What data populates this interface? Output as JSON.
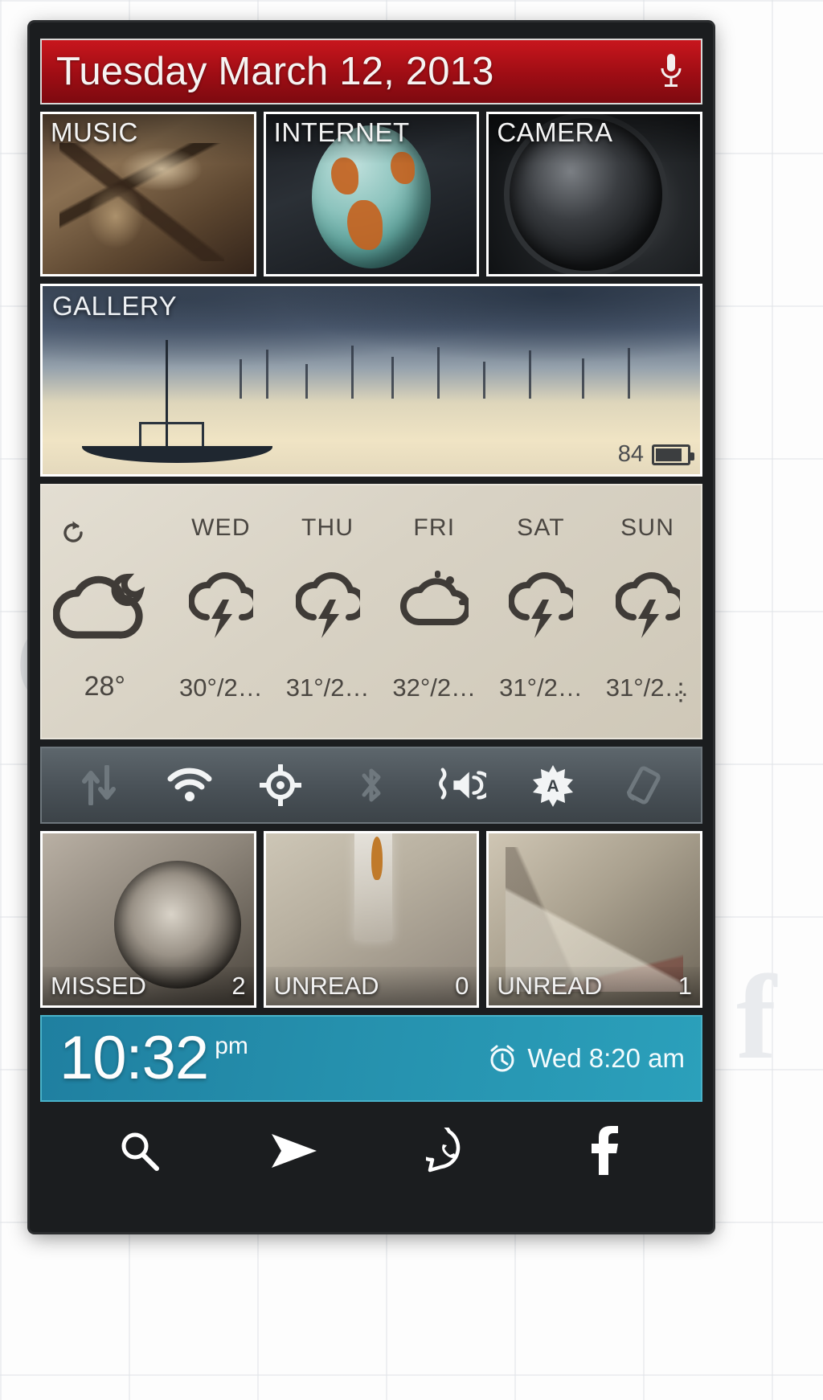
{
  "header": {
    "date": "Tuesday March 12, 2013",
    "mic_icon": "microphone-icon"
  },
  "app_tiles": [
    {
      "label": "MUSIC",
      "icon": "gramophone-image"
    },
    {
      "label": "INTERNET",
      "icon": "globe-image"
    },
    {
      "label": "CAMERA",
      "icon": "camera-lens-image"
    }
  ],
  "gallery": {
    "label": "GALLERY",
    "battery_level": "84",
    "battery_icon": "battery-icon"
  },
  "weather": {
    "refresh_icon": "refresh-icon",
    "more_icon": "overflow-menu-icon",
    "today": {
      "temp": "28°",
      "icon": "cloudy-night-icon"
    },
    "days": [
      {
        "day": "WED",
        "temp": "30°/2…",
        "icon": "thunderstorm-icon"
      },
      {
        "day": "THU",
        "temp": "31°/2…",
        "icon": "thunderstorm-icon"
      },
      {
        "day": "FRI",
        "temp": "32°/2…",
        "icon": "partly-cloudy-icon"
      },
      {
        "day": "SAT",
        "temp": "31°/2…",
        "icon": "thunderstorm-icon"
      },
      {
        "day": "SUN",
        "temp": "31°/2…",
        "icon": "thunderstorm-icon"
      }
    ]
  },
  "toggles": [
    {
      "name": "data-toggle",
      "icon": "data-transfer-icon",
      "state": "off"
    },
    {
      "name": "wifi-toggle",
      "icon": "wifi-icon",
      "state": "on"
    },
    {
      "name": "gps-toggle",
      "icon": "location-icon",
      "state": "on"
    },
    {
      "name": "bluetooth-toggle",
      "icon": "bluetooth-icon",
      "state": "off"
    },
    {
      "name": "sound-toggle",
      "icon": "volume-icon",
      "state": "on"
    },
    {
      "name": "autobrightness-toggle",
      "icon": "brightness-auto-icon",
      "state": "on"
    },
    {
      "name": "rotation-toggle",
      "icon": "screen-rotation-icon",
      "state": "off"
    }
  ],
  "notifications": [
    {
      "label": "MISSED",
      "count": "2",
      "icon": "rotary-phone-image"
    },
    {
      "label": "UNREAD",
      "count": "0",
      "icon": "message-image"
    },
    {
      "label": "UNREAD",
      "count": "1",
      "icon": "mail-image"
    }
  ],
  "clock": {
    "time": "10:32",
    "ampm": "pm",
    "alarm": "Wed 8:20 am",
    "alarm_icon": "alarm-clock-icon"
  },
  "dock": [
    {
      "name": "search",
      "icon": "search-icon"
    },
    {
      "name": "telegram",
      "icon": "send-icon"
    },
    {
      "name": "whatsapp",
      "icon": "whatsapp-icon"
    },
    {
      "name": "facebook",
      "icon": "facebook-icon"
    }
  ],
  "colors": {
    "header_red": "#9e0d14",
    "clock_teal": "#2590ad",
    "weather_paper": "#d8d2c4",
    "toggle_bar": "#4a5258",
    "phone_frame": "#1b1d1f"
  }
}
